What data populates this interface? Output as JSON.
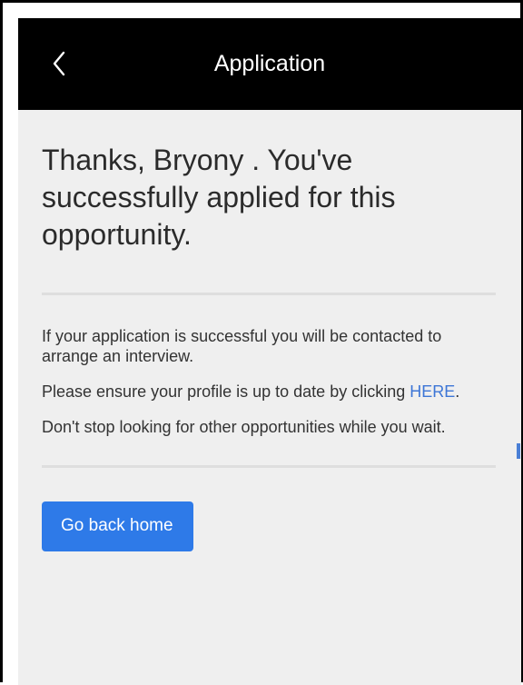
{
  "header": {
    "back_icon": "chevron-left-icon",
    "title": "Application"
  },
  "main": {
    "headline": "Thanks, Bryony . You've successfully applied for this opportunity.",
    "message_1": "If your application is successful you will be contacted to arrange an interview.",
    "message_2_prefix": "Please ensure your profile is up to date by clicking ",
    "message_2_link": "HERE",
    "message_2_suffix": ".",
    "message_3": "Don't stop looking for other opportunities while you wait.",
    "home_button_label": "Go back home"
  },
  "colors": {
    "topbar": "#000000",
    "background": "#efefef",
    "accent": "#2e7ae8",
    "link": "#3d76d6"
  }
}
